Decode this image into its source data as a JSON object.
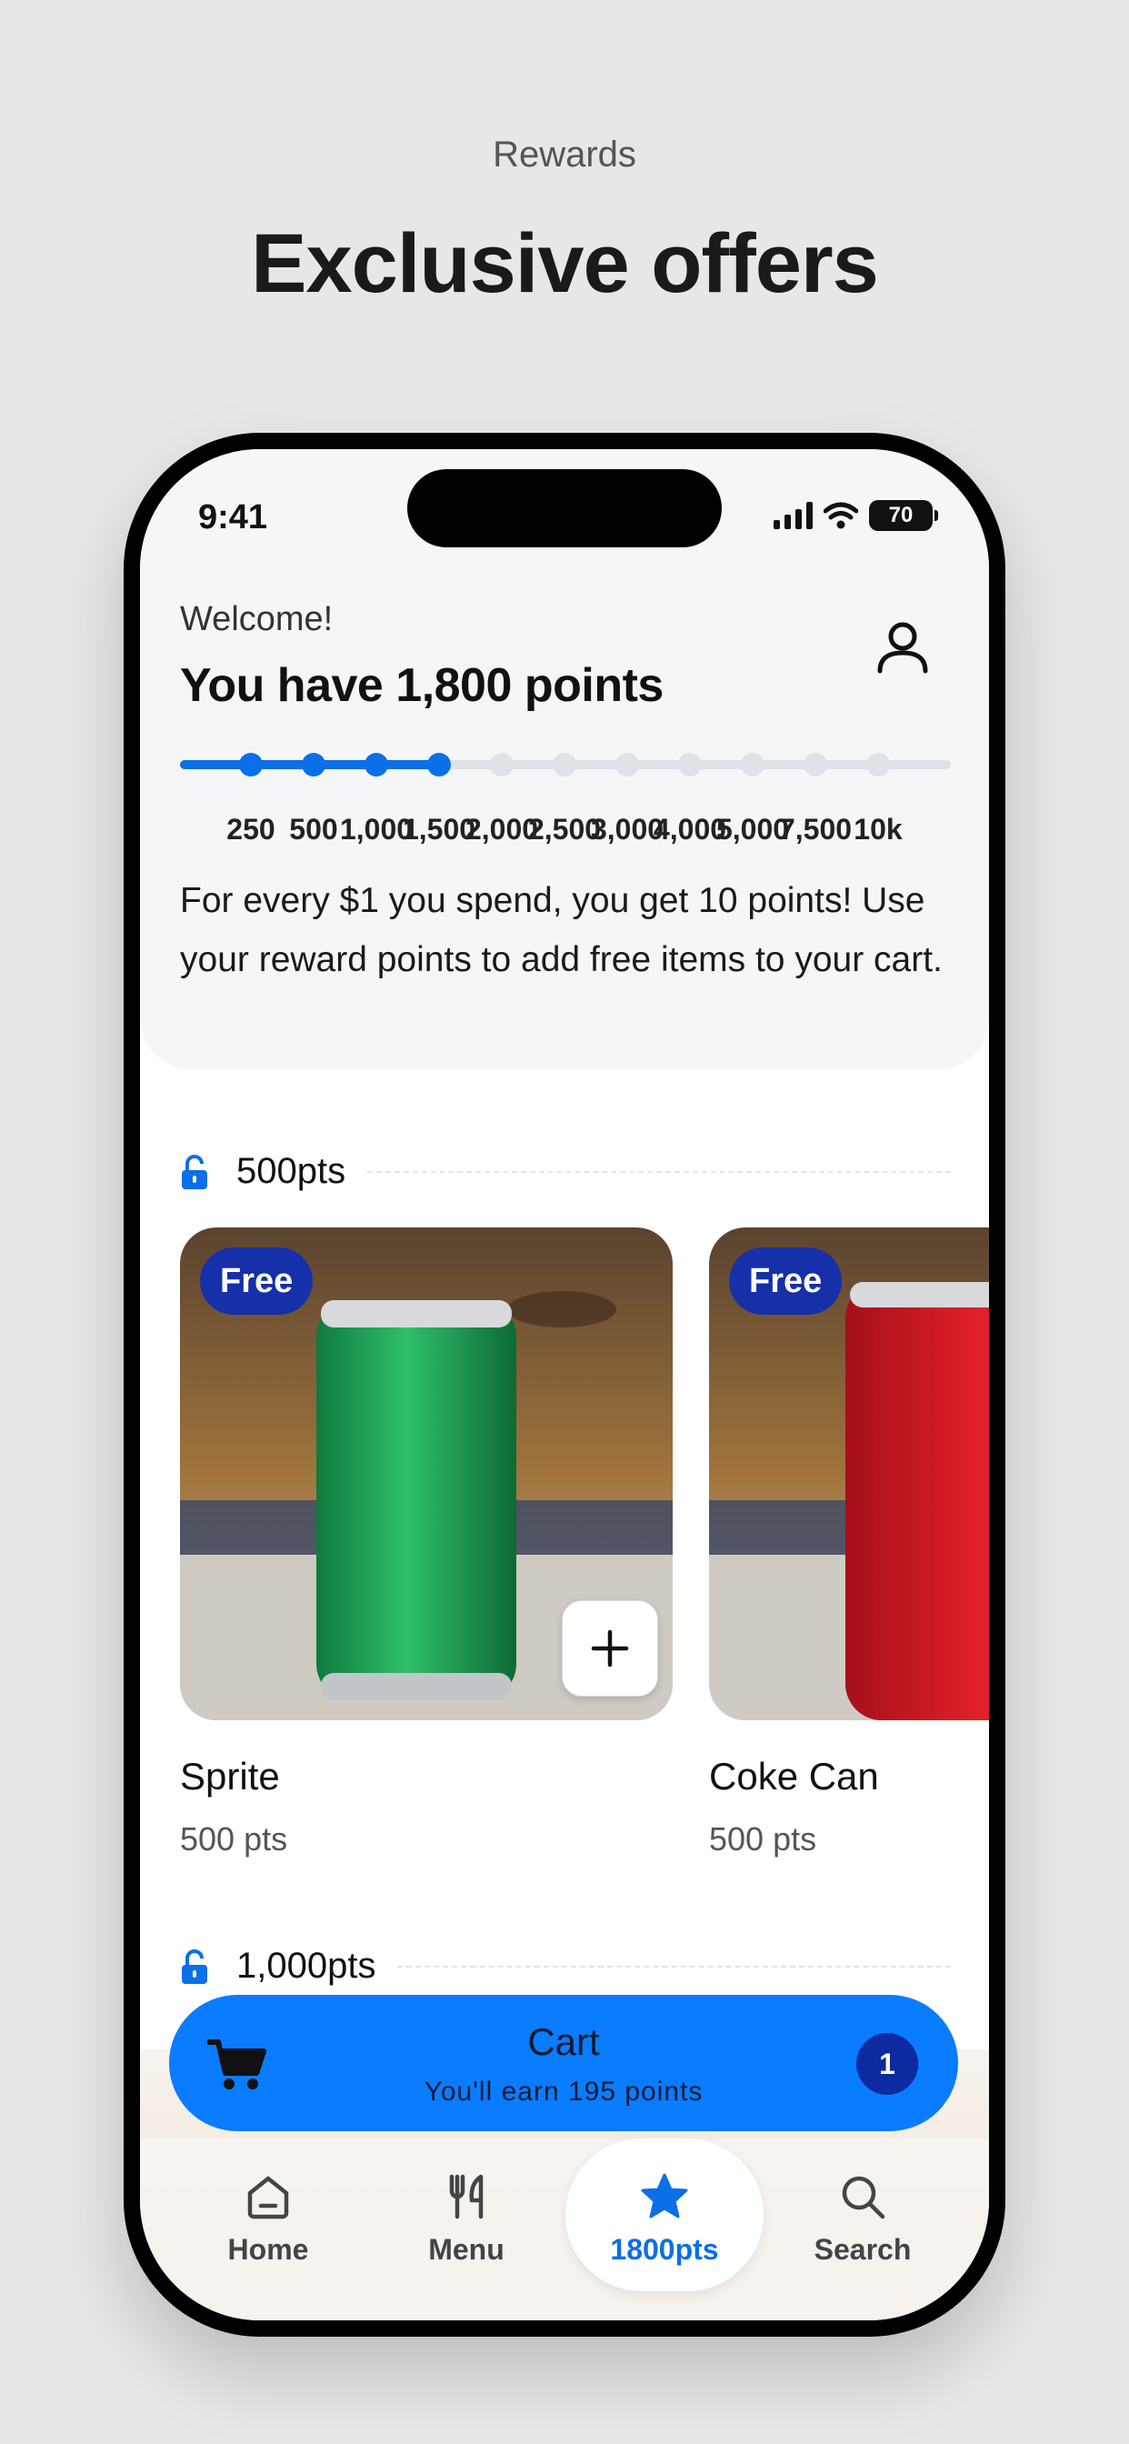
{
  "marketing": {
    "subtitle": "Rewards",
    "title": "Exclusive offers"
  },
  "status_bar": {
    "time": "9:41",
    "battery": "70"
  },
  "header": {
    "welcome": "Welcome!",
    "points_title": "You have 1,800 points",
    "progress_ticks": [
      "250",
      "500",
      "1,000",
      "1,500",
      "2,000",
      "2,500",
      "3,000",
      "4,000",
      "5,000",
      "7,500",
      "10k"
    ],
    "reached_ticks": 4,
    "info": "For every $1 you spend, you get 10 points! Use your reward points to add free items to your cart."
  },
  "sections": [
    {
      "label": "500pts",
      "items": [
        {
          "badge": "Free",
          "name": "Sprite",
          "pts": "500 pts"
        },
        {
          "badge": "Free",
          "name": "Coke Can",
          "pts": "500 pts"
        }
      ]
    },
    {
      "label": "1,000pts"
    }
  ],
  "cart": {
    "title": "Cart",
    "subtitle": "You'll earn 195 points",
    "count": "1"
  },
  "nav": {
    "items": [
      {
        "label": "Home",
        "icon": "home-icon"
      },
      {
        "label": "Menu",
        "icon": "fork-knife-icon"
      },
      {
        "label": "1800pts",
        "icon": "star-icon",
        "active": true
      },
      {
        "label": "Search",
        "icon": "search-icon"
      }
    ]
  },
  "colors": {
    "accent": "#0a6fe8",
    "cart_bar": "#0a7cff",
    "badge": "#1530a8"
  }
}
